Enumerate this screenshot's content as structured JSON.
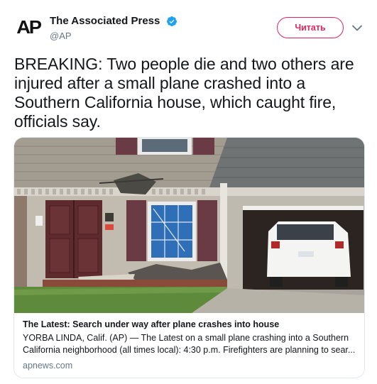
{
  "author": {
    "name": "The Associated Press",
    "handle": "@AP",
    "avatar_text": "AP",
    "verified": true
  },
  "follow_button": {
    "label": "Читать"
  },
  "tweet": {
    "text": "BREAKING: Two people die and two others are injured after a small plane crashed into a Southern California house, which caught fire, officials say."
  },
  "card": {
    "title": "The Latest: Search under way after plane crashes into house",
    "description_line1": "YORBA LINDA, Calif. (AP) — The Latest on a small plane crashing into a Southern",
    "description_line2": "California neighborhood (all times local): 4:30 p.m. Firefighters are planning to sear...",
    "domain": "apnews.com"
  },
  "colors": {
    "accent": "#e0245e",
    "verified": "#1da1f2",
    "text": "#14171a",
    "secondary": "#657786",
    "border": "#e1e8ed"
  },
  "icons": [
    "verified-badge-icon",
    "chevron-down-icon"
  ]
}
